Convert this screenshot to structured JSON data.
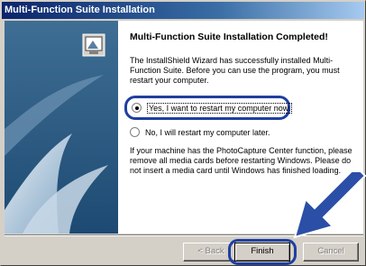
{
  "window": {
    "title": "Multi-Function Suite Installation"
  },
  "content": {
    "heading": "Multi-Function Suite Installation Completed!",
    "message": "The InstallShield Wizard has successfully installed Multi-Function Suite.  Before you can use the program, you must restart your computer.",
    "options": [
      {
        "label": "Yes, I want to restart my computer now.",
        "selected": true
      },
      {
        "label": "No, I will restart my computer later.",
        "selected": false
      }
    ],
    "note": "If your machine has the PhotoCapture Center function, please remove all media cards before restarting Windows. Please do not insert a media card until Windows has finished loading."
  },
  "buttons": {
    "back": "< Back",
    "finish": "Finish",
    "cancel": "Cancel"
  },
  "colors": {
    "title_bar": "#0a246a",
    "highlight": "#1f3fa0",
    "side_panel": "#2f5f86"
  }
}
